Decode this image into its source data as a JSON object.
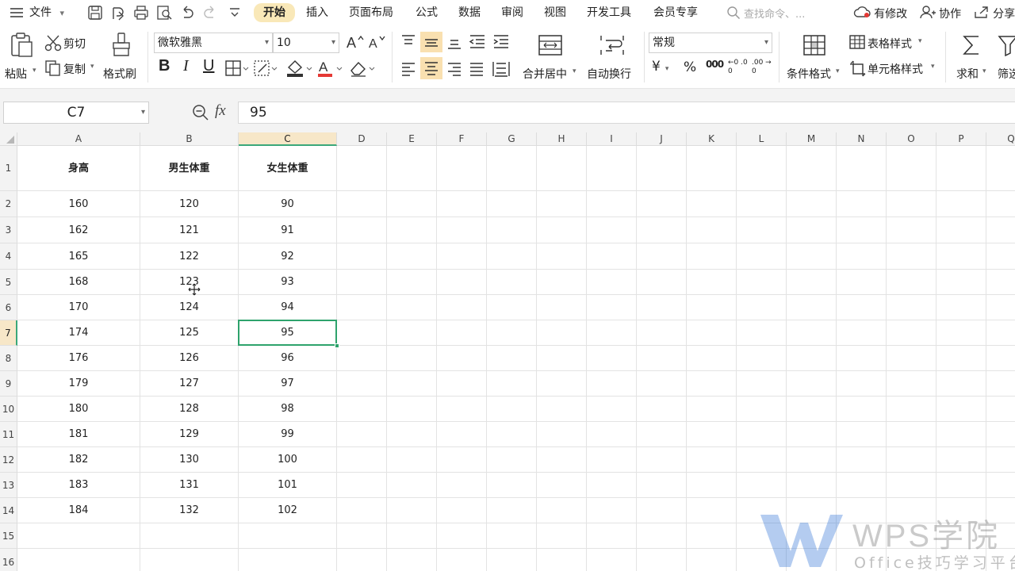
{
  "menubar": {
    "file": "文件",
    "tabs": [
      "开始",
      "插入",
      "页面布局",
      "公式",
      "数据",
      "审阅",
      "视图",
      "开发工具",
      "会员专享"
    ],
    "active_tab": "开始",
    "search_placeholder": "查找命令、...",
    "modified": "有修改",
    "collab": "协作",
    "share": "分享"
  },
  "ribbon": {
    "paste": "粘贴",
    "cut": "剪切",
    "copy": "复制",
    "format_painter": "格式刷",
    "font_name": "微软雅黑",
    "font_size": "10",
    "merge_center": "合并居中",
    "wrap_text": "自动换行",
    "number_format": "常规",
    "conditional_format": "条件格式",
    "table_style": "表格样式",
    "cell_style": "单元格样式",
    "sum": "求和",
    "filter": "筛选",
    "currency_symbol": "¥",
    "percent_symbol": "%",
    "thousands_symbol": "000",
    "inc_decimal": "←0 .00",
    "dec_decimal": ".00 →0",
    "bold": "B",
    "italic": "I",
    "underline": "U",
    "font_color_letter": "A"
  },
  "formula_bar": {
    "name_box": "C7",
    "fx": "fx",
    "value": "95"
  },
  "sheet": {
    "columns": [
      "A",
      "B",
      "C",
      "D",
      "E",
      "F",
      "G",
      "H",
      "I",
      "J",
      "K",
      "L",
      "M",
      "N",
      "O",
      "P",
      "Q"
    ],
    "rows": [
      "1",
      "2",
      "3",
      "4",
      "5",
      "6",
      "7",
      "8",
      "9",
      "10",
      "11",
      "12",
      "13",
      "14",
      "15",
      "16"
    ],
    "selected_column": "C",
    "selected_row": "7",
    "headers": [
      "身高",
      "男生体重",
      "女生体重"
    ],
    "data": [
      [
        "160",
        "120",
        "90"
      ],
      [
        "162",
        "121",
        "91"
      ],
      [
        "165",
        "122",
        "92"
      ],
      [
        "168",
        "123",
        "93"
      ],
      [
        "170",
        "124",
        "94"
      ],
      [
        "174",
        "125",
        "95"
      ],
      [
        "176",
        "126",
        "96"
      ],
      [
        "179",
        "127",
        "97"
      ],
      [
        "180",
        "128",
        "98"
      ],
      [
        "181",
        "129",
        "99"
      ],
      [
        "182",
        "130",
        "100"
      ],
      [
        "183",
        "131",
        "101"
      ],
      [
        "184",
        "132",
        "102"
      ]
    ]
  },
  "watermark": {
    "brand": "WPS学院",
    "sub": "Office技巧学习平台"
  },
  "colors": {
    "accent_green": "#2ea36c",
    "active_tab_bg": "#f9e8b8",
    "header_bg": "#f3f3f3",
    "font_color_red": "#e53935"
  }
}
